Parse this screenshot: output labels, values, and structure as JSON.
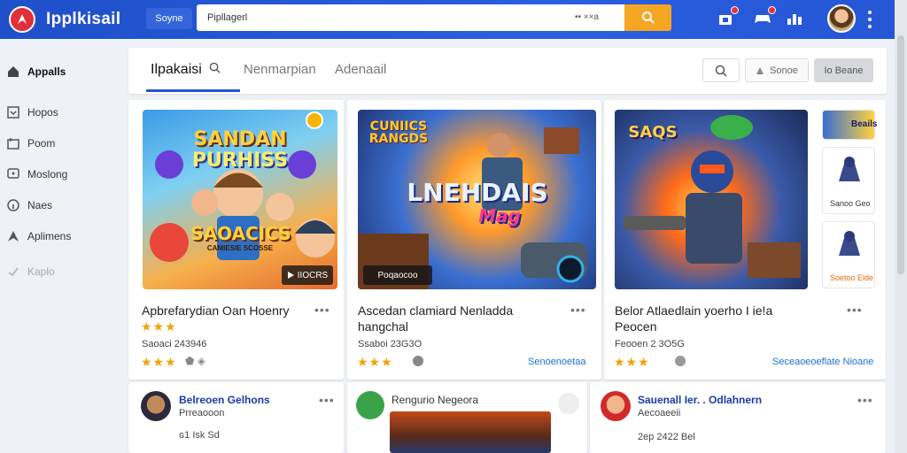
{
  "app": {
    "title": "Ipplkisail",
    "left_button": "Soyne"
  },
  "search": {
    "value": "Pipllagerl",
    "placeholder": "",
    "hint": "•• ××a"
  },
  "sidebar": {
    "items": [
      {
        "label": "Appalls",
        "icon": "home-icon"
      },
      {
        "label": "Hopos",
        "icon": "download-icon"
      },
      {
        "label": "Poom",
        "icon": "cart-icon"
      },
      {
        "label": "Moslong",
        "icon": "chat-icon"
      },
      {
        "label": "Naes",
        "icon": "info-icon"
      },
      {
        "label": "Aplimens",
        "icon": "arrow-icon"
      },
      {
        "label": "Kaplo",
        "icon": "check-icon"
      }
    ]
  },
  "tabs": [
    {
      "label": "Ilpakaisi"
    },
    {
      "label": "Nenmarpian"
    },
    {
      "label": "Adenaail"
    }
  ],
  "toolbar": {
    "btn2": "Sonoe",
    "btn3": "Io Beane"
  },
  "cards": [
    {
      "art_line1": "SANDAN",
      "art_line2": "PURHISS",
      "art_line3": "SAOACICS",
      "art_sub": "CAMIESIE SCOSSE",
      "pill": "IIOCRS",
      "title": "Apbrefarydian Oan Hoenry",
      "meta": "Saoaci 243946",
      "rating": "★★★"
    },
    {
      "art_top": "CUNIICS RANGDS",
      "art_line1": "LNEHDAIS",
      "art_line2": "Mag",
      "pill": "Poqaocoo",
      "title_line1": "Ascedan clamiard Nenladda",
      "title_line2": "hangchal",
      "meta": "Ssaboi 23G3O",
      "rating": "★★★",
      "link": "Senoenoetaa"
    },
    {
      "art_top": "SAQS",
      "title_line1": "Belor Atlaedlain yoerho I ie!a",
      "title_line2": "Peocen",
      "meta": "Feooen 2 3O5G",
      "rating": "★★★",
      "link": "Seceaoeoeflate Nioane"
    }
  ],
  "side_minis": [
    {
      "label": "Sanoo Geo"
    },
    {
      "label": "Soetoo Elde"
    }
  ],
  "side_top_label": "Beails",
  "bottom": [
    {
      "name": "Belreoen Gelhons",
      "sub": "Prreaooon",
      "meta": "ɢ1 Isk Sd"
    },
    {
      "name": "Rengurio Negeora",
      "sub": ""
    },
    {
      "name": "Sauenall Ier. . Odlahnern",
      "sub": "Aecoaeeii",
      "meta": "2ep 2422 Bel"
    }
  ],
  "colors": {
    "accent": "#2556d4",
    "search_button": "#f5a623",
    "star": "#f2a20a",
    "link": "#1f6fd6"
  }
}
